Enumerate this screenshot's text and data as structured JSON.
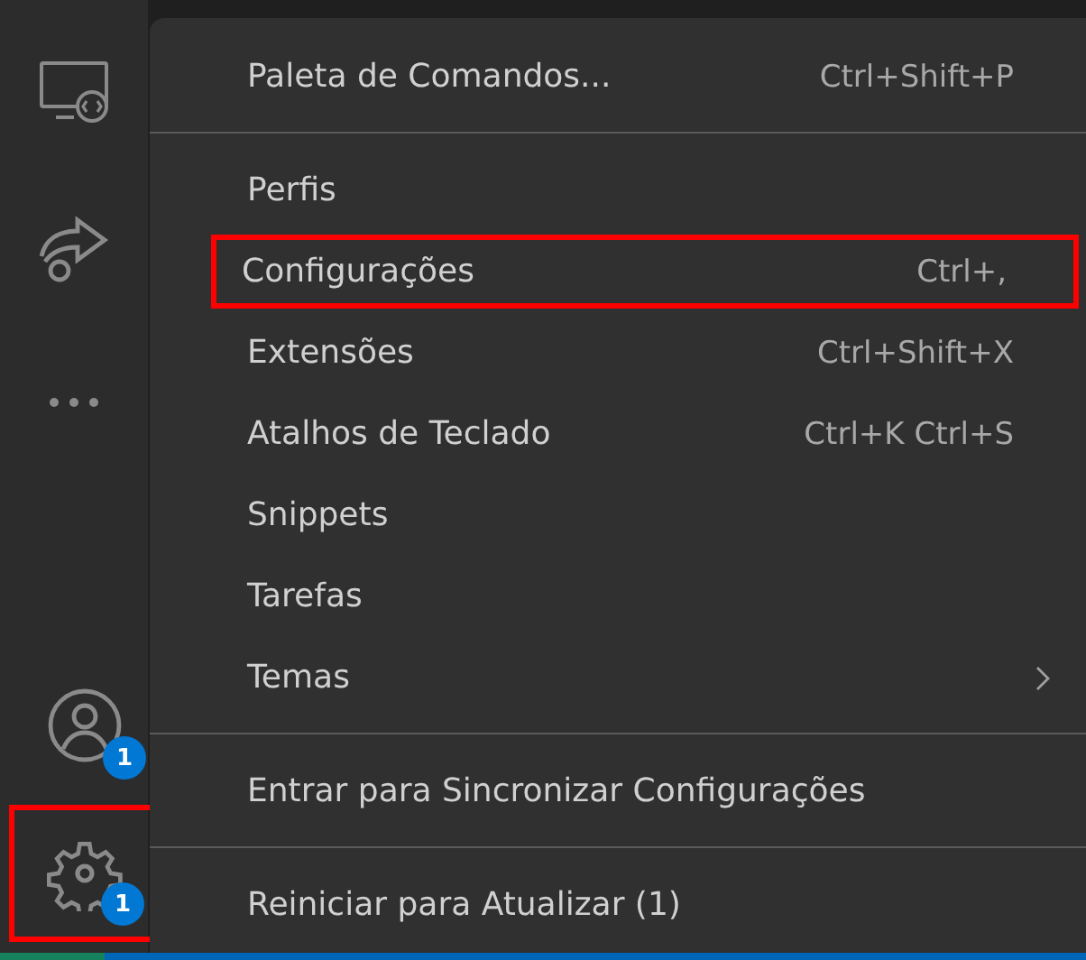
{
  "activity_bar": {
    "items": [
      {
        "kind": "remote",
        "highlighted": false
      },
      {
        "kind": "share",
        "highlighted": false
      },
      {
        "kind": "more",
        "highlighted": false
      },
      {
        "kind": "account",
        "badge": "1",
        "highlighted": false
      },
      {
        "kind": "gear",
        "badge": "1",
        "highlighted": true
      }
    ]
  },
  "menu": {
    "groups": [
      [
        {
          "label": "Paleta de Comandos...",
          "shortcut": "Ctrl+Shift+P",
          "submenu": false,
          "highlighted": false
        }
      ],
      [
        {
          "label": "Perfis",
          "submenu": false,
          "highlighted": false
        },
        {
          "label": "Configurações",
          "shortcut": "Ctrl+,",
          "submenu": false,
          "highlighted": true
        },
        {
          "label": "Extensões",
          "shortcut": "Ctrl+Shift+X",
          "submenu": false,
          "highlighted": false
        },
        {
          "label": "Atalhos de Teclado",
          "shortcut": "Ctrl+K Ctrl+S",
          "submenu": false,
          "highlighted": false
        },
        {
          "label": "Snippets",
          "submenu": false,
          "highlighted": false
        },
        {
          "label": "Tarefas",
          "submenu": false,
          "highlighted": false
        },
        {
          "label": "Temas",
          "submenu": true,
          "highlighted": false
        }
      ],
      [
        {
          "label": "Entrar para Sincronizar Configurações",
          "submenu": false,
          "highlighted": false
        }
      ],
      [
        {
          "label": "Reiniciar para Atualizar (1)",
          "submenu": false,
          "highlighted": false
        }
      ]
    ]
  }
}
